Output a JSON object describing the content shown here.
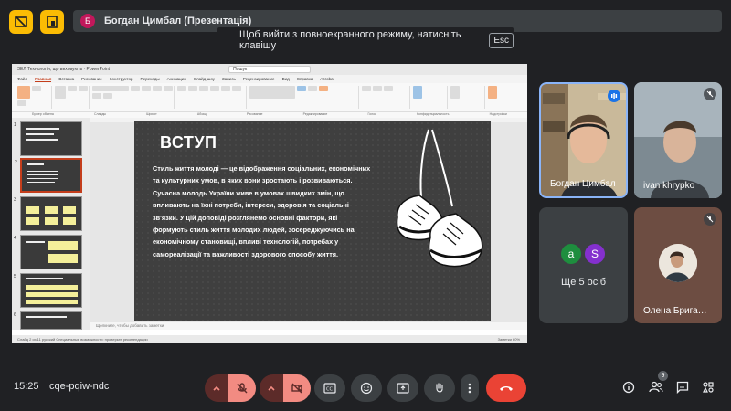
{
  "top": {
    "presenter_initial": "Б",
    "presenter_label": "Богдан Цимбал (Презентація)"
  },
  "toast": {
    "text": "Щоб вийти з повноекранного режиму, натисніть клавішу",
    "key": "Esc"
  },
  "ppt": {
    "title": "ЗЕЛ Технологія, що виховують · PowerPoint",
    "search": "Пошук",
    "tabs": [
      "Файл",
      "Главная",
      "Вставка",
      "Рисование",
      "Конструктор",
      "Переходы",
      "Анимация",
      "Слайд-шоу",
      "Запись",
      "Рецензирование",
      "Вид",
      "Справка",
      "Acrobat"
    ],
    "active_tab": "Главная",
    "ribbon_groups": [
      "Буфер обмена",
      "Слайды",
      "Шрифт",
      "Абзац",
      "Рисование",
      "Редактирование",
      "Голос",
      "Конфиденциальность",
      "Надстройки"
    ],
    "slide": {
      "title": "ВСТУП",
      "body": "Стиль життя молоді — це відображення соціальних, економічних та культурних умов, в яких вони зростають і розвиваються. Сучасна молодь України живе в умовах швидких змін, що впливають на їхні потреби, інтереси, здоров'я та соціальні зв'язки. У цій доповіді розглянемо основні фактори, які формують стиль життя молодих людей, зосереджуючись на економічному становищі, впливі технологій, потребах у самореалізації та важливості здорового способу життя."
    },
    "thumb_numbers": [
      "1",
      "2",
      "3",
      "4",
      "5",
      "6"
    ],
    "notes_placeholder": "Щелкните, чтобы добавить заметки",
    "status_left": "Слайд 2 из 11   русский   Специальные возможности: проверьте рекомендации",
    "status_right": "Заметки   60%"
  },
  "participants": [
    {
      "name": "Богдан Цимбал",
      "speaking": true
    },
    {
      "name": "ivan khrypko",
      "muted": true
    },
    {
      "name": "Ще 5 осіб",
      "initials": [
        "a",
        "S"
      ],
      "colors": [
        "#1e8e3e",
        "#8430ce"
      ]
    },
    {
      "name": "Олена Бригадир",
      "display": "Олена Брига…",
      "muted": true
    }
  ],
  "bottom": {
    "time": "15:25",
    "meeting_code": "cqe-pqiw-ndc",
    "people_count": "9"
  }
}
